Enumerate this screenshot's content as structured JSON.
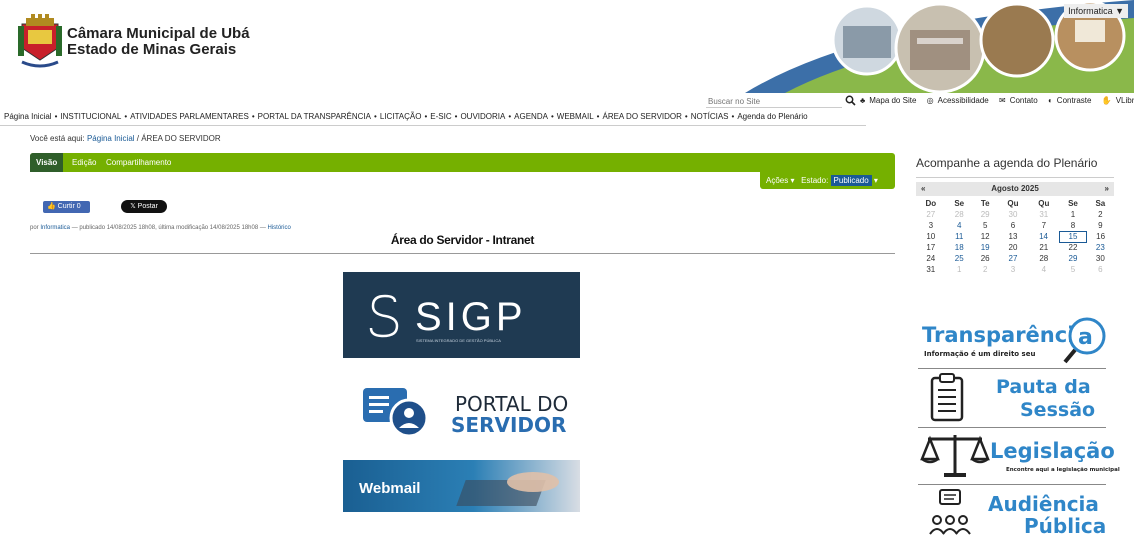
{
  "header": {
    "site_line1": "Câmara Municipal de Ubá",
    "site_line2": "Estado de Minas Gerais",
    "user_menu": "Informatica ▼"
  },
  "utility": {
    "search_placeholder": "Buscar no Site",
    "links": [
      "Mapa do Site",
      "Acessibilidade",
      "Contato",
      "Contraste",
      "VLibras"
    ]
  },
  "nav": {
    "items": [
      "Página Inicial",
      "INSTITUCIONAL",
      "ATIVIDADES PARLAMENTARES",
      "PORTAL DA TRANSPARÊNCIA",
      "LICITAÇÃO",
      "E-SIC",
      "OUVIDORIA",
      "AGENDA",
      "WEBMAIL",
      "ÁREA DO SERVIDOR",
      "NOTÍCIAS",
      "Agenda do Plenário"
    ]
  },
  "breadcrumb": {
    "prefix": "Você está aqui:",
    "home": "Página Inicial",
    "sep": " / ",
    "current": "ÁREA DO SERVIDOR"
  },
  "edit_bar": {
    "tabs": [
      "Visão",
      "Edição",
      "Compartilhamento"
    ],
    "actions": "Ações ▾",
    "state_label": "Estado:",
    "state_value": "Publicado"
  },
  "social": {
    "like": "Curtir 0",
    "post": "Postar"
  },
  "byline": {
    "prefix": "por",
    "author": "Informatica",
    "text": " — publicado 14/08/2025 18h08, última modificação 14/08/2025 18h08 — ",
    "history": "Histórico"
  },
  "page_title": "Área do Servidor - Intranet",
  "banners": {
    "sigp_title": "SIGP",
    "sigp_subtitle": "SISTEMA INTEGRADO DE GESTÃO PÚBLICA",
    "portal_line1": "PORTAL DO",
    "portal_line2": "SERVIDOR",
    "webmail": "Webmail"
  },
  "sidebar": {
    "title": "Acompanhe a agenda do Plenário",
    "calendar": {
      "prev": "«",
      "next": "»",
      "month": "Agosto 2025",
      "weekdays": [
        "Do",
        "Se",
        "Te",
        "Qu",
        "Qu",
        "Se",
        "Sa"
      ],
      "weeks": [
        [
          {
            "d": "27",
            "t": "other"
          },
          {
            "d": "28",
            "t": "other"
          },
          {
            "d": "29",
            "t": "other"
          },
          {
            "d": "30",
            "t": "other"
          },
          {
            "d": "31",
            "t": "other"
          },
          {
            "d": "1",
            "t": ""
          },
          {
            "d": "2",
            "t": ""
          }
        ],
        [
          {
            "d": "3",
            "t": ""
          },
          {
            "d": "4",
            "t": "event"
          },
          {
            "d": "5",
            "t": ""
          },
          {
            "d": "6",
            "t": ""
          },
          {
            "d": "7",
            "t": ""
          },
          {
            "d": "8",
            "t": ""
          },
          {
            "d": "9",
            "t": ""
          }
        ],
        [
          {
            "d": "10",
            "t": ""
          },
          {
            "d": "11",
            "t": "event"
          },
          {
            "d": "12",
            "t": ""
          },
          {
            "d": "13",
            "t": ""
          },
          {
            "d": "14",
            "t": "event"
          },
          {
            "d": "15",
            "t": "today"
          },
          {
            "d": "16",
            "t": ""
          }
        ],
        [
          {
            "d": "17",
            "t": ""
          },
          {
            "d": "18",
            "t": "event"
          },
          {
            "d": "19",
            "t": "event"
          },
          {
            "d": "20",
            "t": ""
          },
          {
            "d": "21",
            "t": ""
          },
          {
            "d": "22",
            "t": ""
          },
          {
            "d": "23",
            "t": "event"
          }
        ],
        [
          {
            "d": "24",
            "t": ""
          },
          {
            "d": "25",
            "t": "event"
          },
          {
            "d": "26",
            "t": ""
          },
          {
            "d": "27",
            "t": "event"
          },
          {
            "d": "28",
            "t": ""
          },
          {
            "d": "29",
            "t": "event"
          },
          {
            "d": "30",
            "t": ""
          }
        ],
        [
          {
            "d": "31",
            "t": ""
          },
          {
            "d": "1",
            "t": "other"
          },
          {
            "d": "2",
            "t": "other"
          },
          {
            "d": "3",
            "t": "other"
          },
          {
            "d": "4",
            "t": "other"
          },
          {
            "d": "5",
            "t": "other"
          },
          {
            "d": "6",
            "t": "other"
          }
        ]
      ]
    },
    "promos": {
      "transparencia_title": "Transparênci",
      "transparencia_letter": "a",
      "transparencia_sub": "Informação é um direito seu",
      "pauta_line1": "Pauta da",
      "pauta_line2": "Sessão",
      "legislacao_title": "Legislação",
      "legislacao_sub": "Encontre aqui a legislação municipal",
      "audiencia_line1": "Audiência",
      "audiencia_line2": "Pública"
    }
  },
  "colors": {
    "green": "#75b000",
    "dark_green": "#2f5e2a",
    "link_blue": "#1a5a96",
    "promo_blue": "#2f86c8",
    "sigp_bg": "#1f3a52"
  }
}
